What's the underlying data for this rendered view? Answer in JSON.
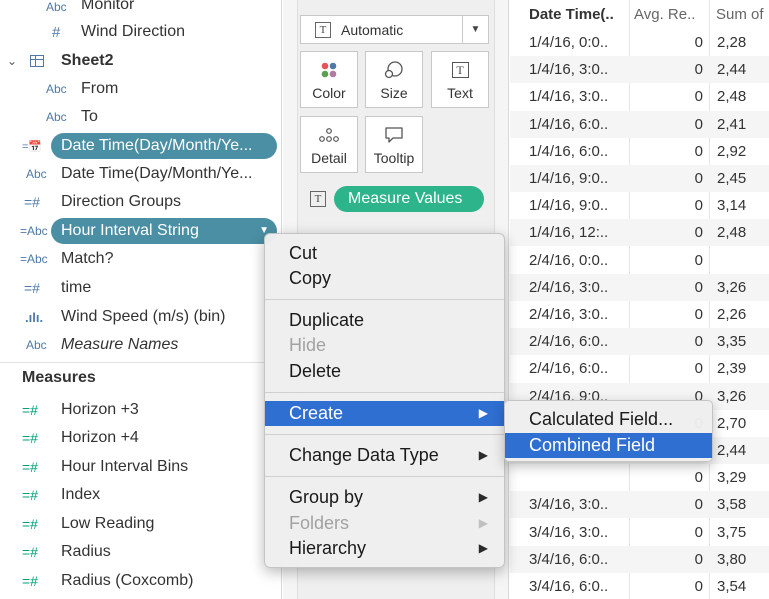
{
  "data_pane": {
    "dimension_items": [
      {
        "type": "Abc",
        "label": "Monitor"
      },
      {
        "type": "#",
        "label": "Wind Direction"
      }
    ],
    "sheet2": {
      "label": "Sheet2"
    },
    "sheet2_items": [
      {
        "type": "Abc",
        "label": "From"
      },
      {
        "type": "Abc",
        "label": "To"
      }
    ],
    "fields": [
      {
        "type": "=date",
        "label": "Date Time(Day/Month/Ye...",
        "pill": true
      },
      {
        "type": "Abc",
        "label": "Date Time(Day/Month/Ye..."
      },
      {
        "type": "=#",
        "label": "Direction Groups"
      },
      {
        "type": "=Abc",
        "label": "Hour Interval String",
        "pill": true
      },
      {
        "type": "=Abc",
        "label": "Match?"
      },
      {
        "type": "=#",
        "label": "time"
      },
      {
        "type": "bin",
        "label": "Wind Speed (m/s) (bin)"
      },
      {
        "type": "Abc",
        "label": "Measure Names",
        "italic": true
      }
    ],
    "measures_header": "Measures",
    "measures": [
      {
        "type": "=#",
        "label": "Horizon +3"
      },
      {
        "type": "=#",
        "label": "Horizon +4"
      },
      {
        "type": "=#",
        "label": "Hour Interval Bins"
      },
      {
        "type": "=#",
        "label": "Index"
      },
      {
        "type": "=#",
        "label": "Low Reading"
      },
      {
        "type": "=#",
        "label": "Radius"
      },
      {
        "type": "=#",
        "label": "Radius (Coxcomb)"
      }
    ]
  },
  "marks": {
    "mark_type": "Automatic",
    "mark_type_icon": "T",
    "buttons": [
      {
        "label": "Color",
        "icon": "color-dots-icon"
      },
      {
        "label": "Size",
        "icon": "size-circles-icon"
      },
      {
        "label": "Text",
        "icon": "text-t-icon",
        "glyph": "T"
      },
      {
        "label": "Detail",
        "icon": "detail-dots-icon"
      },
      {
        "label": "Tooltip",
        "icon": "tooltip-bubble-icon"
      }
    ],
    "measure_values_icon": "T",
    "measure_values": "Measure Values"
  },
  "grid": {
    "headers": [
      "Date Time(..",
      "Avg. Re..",
      "Sum of"
    ],
    "rows": [
      {
        "date": "1/4/16, 0:0..",
        "avg": "0",
        "sum": "2,28"
      },
      {
        "date": "1/4/16, 3:0..",
        "avg": "0",
        "sum": "2,44"
      },
      {
        "date": "1/4/16, 3:0..",
        "avg": "0",
        "sum": "2,48"
      },
      {
        "date": "1/4/16, 6:0..",
        "avg": "0",
        "sum": "2,41"
      },
      {
        "date": "1/4/16, 6:0..",
        "avg": "0",
        "sum": "2,92"
      },
      {
        "date": "1/4/16, 9:0..",
        "avg": "0",
        "sum": "2,45"
      },
      {
        "date": "1/4/16, 9:0..",
        "avg": "0",
        "sum": "3,14"
      },
      {
        "date": "1/4/16, 12:..",
        "avg": "0",
        "sum": "2,48"
      },
      {
        "date": "2/4/16, 0:0..",
        "avg": "0",
        "sum": ""
      },
      {
        "date": "2/4/16, 3:0..",
        "avg": "0",
        "sum": "3,26"
      },
      {
        "date": "2/4/16, 3:0..",
        "avg": "0",
        "sum": "2,26"
      },
      {
        "date": "2/4/16, 6:0..",
        "avg": "0",
        "sum": "3,35"
      },
      {
        "date": "2/4/16, 6:0..",
        "avg": "0",
        "sum": "2,39"
      },
      {
        "date": "2/4/16, 9:0..",
        "avg": "0",
        "sum": "3,26"
      },
      {
        "date": "",
        "avg": "0",
        "sum": "2,70"
      },
      {
        "date": "",
        "avg": "0",
        "sum": "2,44"
      },
      {
        "date": "",
        "avg": "0",
        "sum": "3,29"
      },
      {
        "date": "3/4/16, 3:0..",
        "avg": "0",
        "sum": "3,58"
      },
      {
        "date": "3/4/16, 3:0..",
        "avg": "0",
        "sum": "3,75"
      },
      {
        "date": "3/4/16, 6:0..",
        "avg": "0",
        "sum": "3,80"
      },
      {
        "date": "3/4/16, 6:0..",
        "avg": "0",
        "sum": "3,54"
      }
    ]
  },
  "context_menu": {
    "items": [
      {
        "label": "Cut"
      },
      {
        "label": "Copy"
      },
      {
        "label": "Duplicate"
      },
      {
        "label": "Hide",
        "disabled": true
      },
      {
        "label": "Delete"
      },
      {
        "label": "Create",
        "submenu": true,
        "active": true
      },
      {
        "label": "Change Data Type",
        "submenu": true
      },
      {
        "label": "Group by",
        "submenu": true
      },
      {
        "label": "Folders",
        "submenu": true,
        "disabled": true
      },
      {
        "label": "Hierarchy",
        "submenu": true
      }
    ],
    "submenu_arrow": "▶",
    "create_submenu": [
      {
        "label": "Calculated Field..."
      },
      {
        "label": "Combined Field",
        "active": true
      }
    ]
  },
  "colors": {
    "pill_dimension": "#4b8fa5",
    "pill_measure": "#2db48a",
    "menu_highlight": "#2f6fd1"
  }
}
